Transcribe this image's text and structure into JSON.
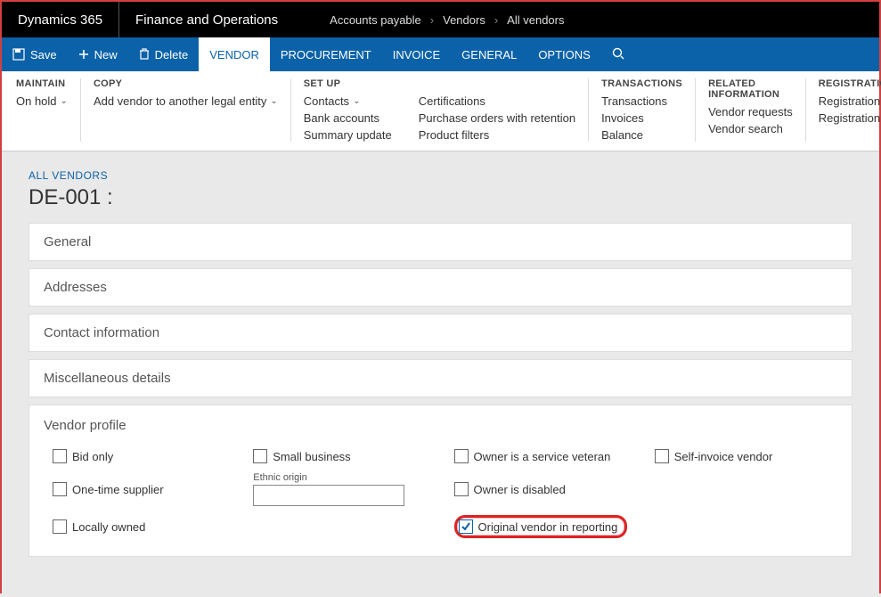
{
  "topbar": {
    "brand": "Dynamics 365",
    "module": "Finance and Operations",
    "breadcrumbs": [
      "Accounts payable",
      "Vendors",
      "All vendors"
    ]
  },
  "actionbar": {
    "save": "Save",
    "new": "New",
    "delete": "Delete",
    "tabs": {
      "vendor": "VENDOR",
      "procurement": "PROCUREMENT",
      "invoice": "INVOICE",
      "general": "GENERAL",
      "options": "OPTIONS"
    }
  },
  "ribbon": {
    "maintain": {
      "title": "MAINTAIN",
      "onhold": "On hold"
    },
    "copy": {
      "title": "COPY",
      "add": "Add vendor to another legal entity"
    },
    "setup": {
      "title": "SET UP",
      "col1": [
        "Contacts",
        "Bank accounts",
        "Summary update"
      ],
      "col2": [
        "Certifications",
        "Purchase orders with retention",
        "Product filters"
      ]
    },
    "transactions": {
      "title": "TRANSACTIONS",
      "items": [
        "Transactions",
        "Invoices",
        "Balance"
      ]
    },
    "related": {
      "title": "RELATED INFORMATION",
      "items": [
        "Vendor requests",
        "Vendor search"
      ]
    },
    "registration": {
      "title": "REGISTRATION",
      "items": [
        "Registration IDs",
        "Registration ID search"
      ]
    }
  },
  "page": {
    "listTitle": "ALL VENDORS",
    "title": "DE-001 :",
    "sections": {
      "general": "General",
      "addresses": "Addresses",
      "contact": "Contact information",
      "misc": "Miscellaneous details"
    },
    "vendorProfile": {
      "title": "Vendor profile",
      "bidOnly": "Bid only",
      "oneTime": "One-time supplier",
      "locallyOwned": "Locally owned",
      "smallBusiness": "Small business",
      "ethnicOrigin": "Ethnic origin",
      "ownerVeteran": "Owner is a service veteran",
      "ownerDisabled": "Owner is disabled",
      "originalVendor": "Original vendor in reporting",
      "selfInvoice": "Self-invoice vendor"
    }
  }
}
